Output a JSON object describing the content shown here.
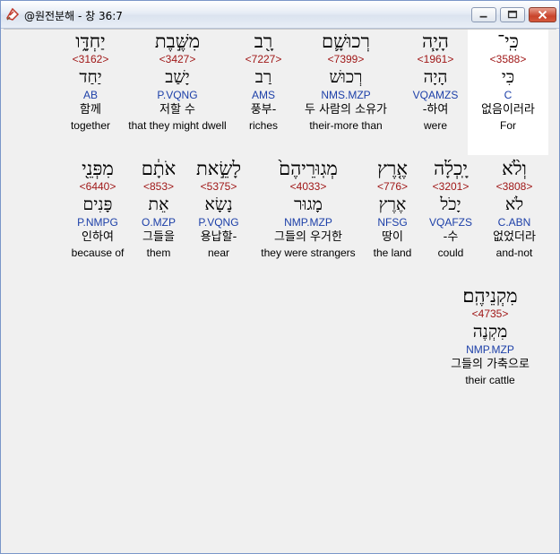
{
  "window": {
    "title": "@원전분해 - 창 36:7"
  },
  "words": [
    {
      "heb": "כִּֽי־",
      "strong": "<3588>",
      "lemma": "כִּי",
      "parse": "C",
      "kor": "없음이러라",
      "eng": "For",
      "highlight": true
    },
    {
      "heb": "הָיָ֧ה",
      "strong": "<1961>",
      "lemma": "הָיָה",
      "parse": "VQAMZS",
      "kor": "-하여",
      "eng": "were"
    },
    {
      "heb": "רְכוּשָׁ֛ם",
      "strong": "<7399>",
      "lemma": "רְכוּשׁ",
      "parse": "NMS.MZP",
      "kor": "두 사람의 소유가",
      "eng": "their-more than"
    },
    {
      "heb": "רָ֖ב",
      "strong": "<7227>",
      "lemma": "רַב",
      "parse": "AMS",
      "kor": "풍부-",
      "eng": "riches"
    },
    {
      "heb": "מִשֶּׁ֣בֶת",
      "strong": "<3427>",
      "lemma": "יָשַׁב",
      "parse": "P.VQNG",
      "kor": "저할 수",
      "eng": "that they might dwell"
    },
    {
      "heb": "יַחְדָּ֑ו",
      "strong": "<3162>",
      "lemma": "יַחַד",
      "parse": "AB",
      "kor": "함께",
      "eng": "together"
    },
    {
      "heb": "וְלֹ֨א",
      "strong": "<3808>",
      "lemma": "לֹא",
      "parse": "C.ABN",
      "kor": "없었더라",
      "eng": "and-not"
    },
    {
      "heb": "יָֽכְלָ֜ה",
      "strong": "<3201>",
      "lemma": "יָכֹל",
      "parse": "VQAFZS",
      "kor": "-수",
      "eng": "could"
    },
    {
      "heb": "אֶ֤רֶץ",
      "strong": "<776>",
      "lemma": "אֶרֶץ",
      "parse": "NFSG",
      "kor": "땅이",
      "eng": "the land"
    },
    {
      "heb": "מְגֽוּרֵיהֶם֙",
      "strong": "<4033>",
      "lemma": "מָגוּר",
      "parse": "NMP.MZP",
      "kor": "그들의 우거한",
      "eng": "they were strangers"
    },
    {
      "heb": "לָשֵׂ֣את",
      "strong": "<5375>",
      "lemma": "נָשָׂא",
      "parse": "P.VQNG",
      "kor": "용납할-",
      "eng": "near"
    },
    {
      "heb": "אֹתָ֔ם",
      "strong": "<853>",
      "lemma": "אֵת",
      "parse": "O.MZP",
      "kor": "그들을",
      "eng": "them"
    },
    {
      "heb": "מִפְּנֵ֖י",
      "strong": "<6440>",
      "lemma": "פָּנִים",
      "parse": "P.NMPG",
      "kor": "인하여",
      "eng": "because of"
    },
    {
      "heb": "מִקְנֵיהֶֽם׃",
      "strong": "<4735>",
      "lemma": "מִקְנֶה",
      "parse": "NMP.MZP",
      "kor": "그들의 가축으로",
      "eng": "their cattle"
    }
  ]
}
